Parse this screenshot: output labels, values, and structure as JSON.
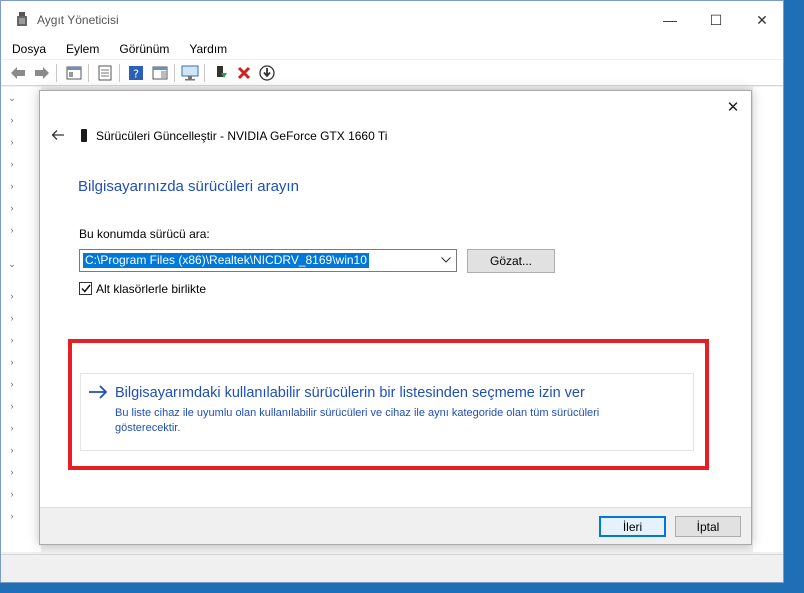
{
  "window": {
    "title": "Aygıt Yöneticisi",
    "minimize_glyph": "—",
    "maximize_glyph": "☐",
    "close_glyph": "✕"
  },
  "menu": {
    "items": [
      "Dosya",
      "Eylem",
      "Görünüm",
      "Yardım"
    ]
  },
  "dialog": {
    "title": "Sürücüleri Güncelleştir - NVIDIA GeForce GTX 1660 Ti",
    "heading": "Bilgisayarınızda sürücüleri arayın",
    "search_label": "Bu konumda sürücü ara:",
    "path_value": "C:\\Program Files (x86)\\Realtek\\NICDRV_8169\\win10",
    "browse_label": "Gözat...",
    "include_subfolders_label": "Alt klasörlerle birlikte",
    "include_subfolders_checked": true,
    "option_title": "Bilgisayarımdaki kullanılabilir sürücülerin bir listesinden seçmeme izin ver",
    "option_description": "Bu liste cihaz ile uyumlu olan kullanılabilir sürücüleri ve cihaz ile aynı kategoride olan tüm sürücüleri gösterecektir.",
    "next_label": "İleri",
    "cancel_label": "İptal",
    "close_glyph": "✕"
  },
  "colors": {
    "link_blue": "#1f4fb8",
    "highlight_red": "#e41f26",
    "selection_blue": "#0078d7"
  }
}
